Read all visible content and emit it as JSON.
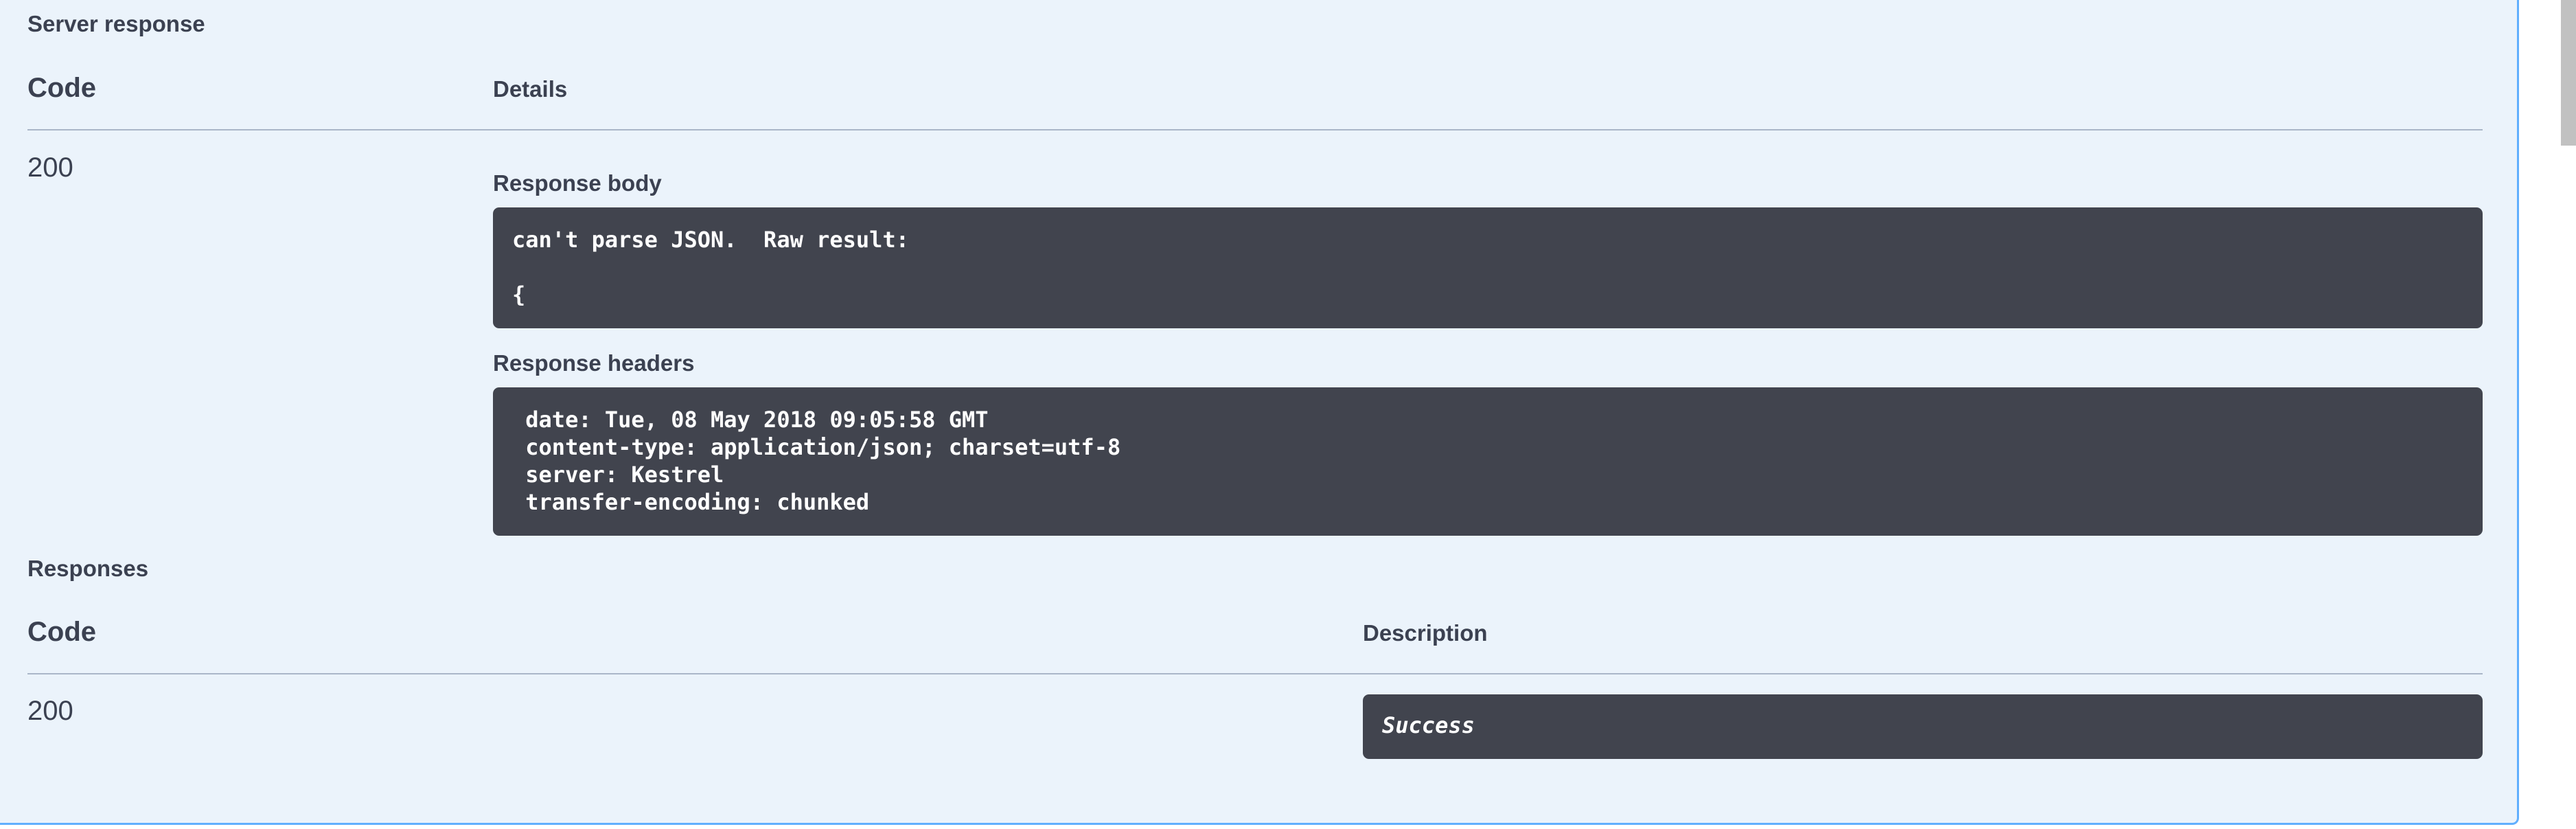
{
  "server_response": {
    "title": "Server response",
    "code_header": "Code",
    "details_header": "Details",
    "code": "200",
    "response_body_label": "Response body",
    "response_body_lines": [
      "can't parse JSON.  Raw result:",
      "",
      "{"
    ],
    "response_headers_label": "Response headers",
    "response_headers_lines": [
      " date: Tue, 08 May 2018 09:05:58 GMT",
      " content-type: application/json; charset=utf-8",
      " server: Kestrel",
      " transfer-encoding: chunked"
    ]
  },
  "responses": {
    "title": "Responses",
    "code_header": "Code",
    "description_header": "Description",
    "code": "200",
    "description": "Success"
  },
  "colors": {
    "panel_bg": "#ebf3fb",
    "panel_border": "#61affe",
    "code_bg": "#41444e",
    "text": "#3b4151"
  }
}
